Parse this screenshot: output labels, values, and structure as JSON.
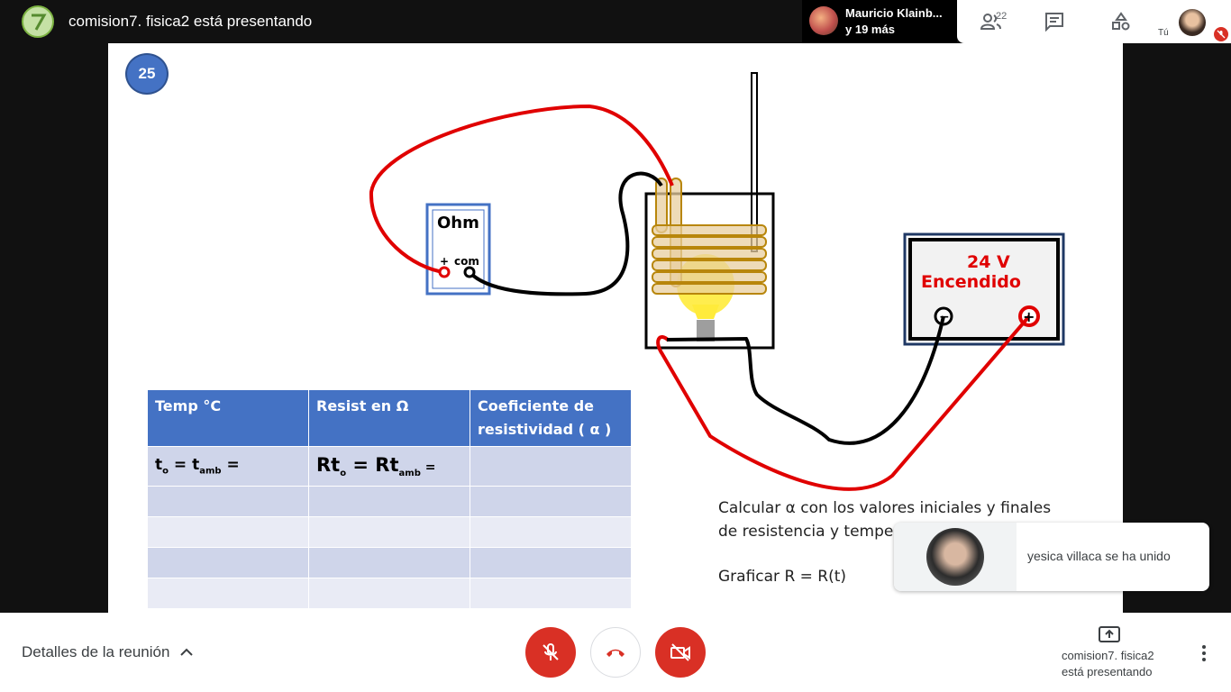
{
  "topbar": {
    "presenting_title": "comision7. fisica2 está presentando",
    "participant_name": "Mauricio Klainb...",
    "participant_more": "y 19 más",
    "people_count": "22",
    "you_label": "Tú"
  },
  "slide": {
    "number": "25",
    "ohmmeter": {
      "label": "Ohm",
      "plus": "+",
      "com": "com"
    },
    "power_supply": {
      "voltage": "24 V",
      "status": "Encendido",
      "neg": "−",
      "pos": "+"
    },
    "table": {
      "headers": [
        "Temp  °C",
        "Resist  en  Ω",
        "Coeficiente de resistividad  ( α )"
      ],
      "first_row": {
        "t_main": "t",
        "t_sub": "o",
        "t_eq": " = t",
        "t_amb": "amb",
        "t_end": " =",
        "r_main": "Rt",
        "r_sub": "o",
        "r_eq": " = Rt",
        "r_amb": "amb",
        "r_end": " ="
      }
    },
    "calc_line1": "Calcular  α  con los valores iniciales y finales",
    "calc_line2": "de resistencia y temper",
    "graph_line": "Graficar  R = R(t)"
  },
  "toast": {
    "text": "yesica villaca se ha unido"
  },
  "bottombar": {
    "meeting_details": "Detalles de la reunión",
    "present_line1": "comision7. fisica2",
    "present_line2": "está presentando"
  },
  "colors": {
    "accent_red": "#d93025",
    "table_blue": "#4472c4",
    "wire_red": "#e00000"
  }
}
